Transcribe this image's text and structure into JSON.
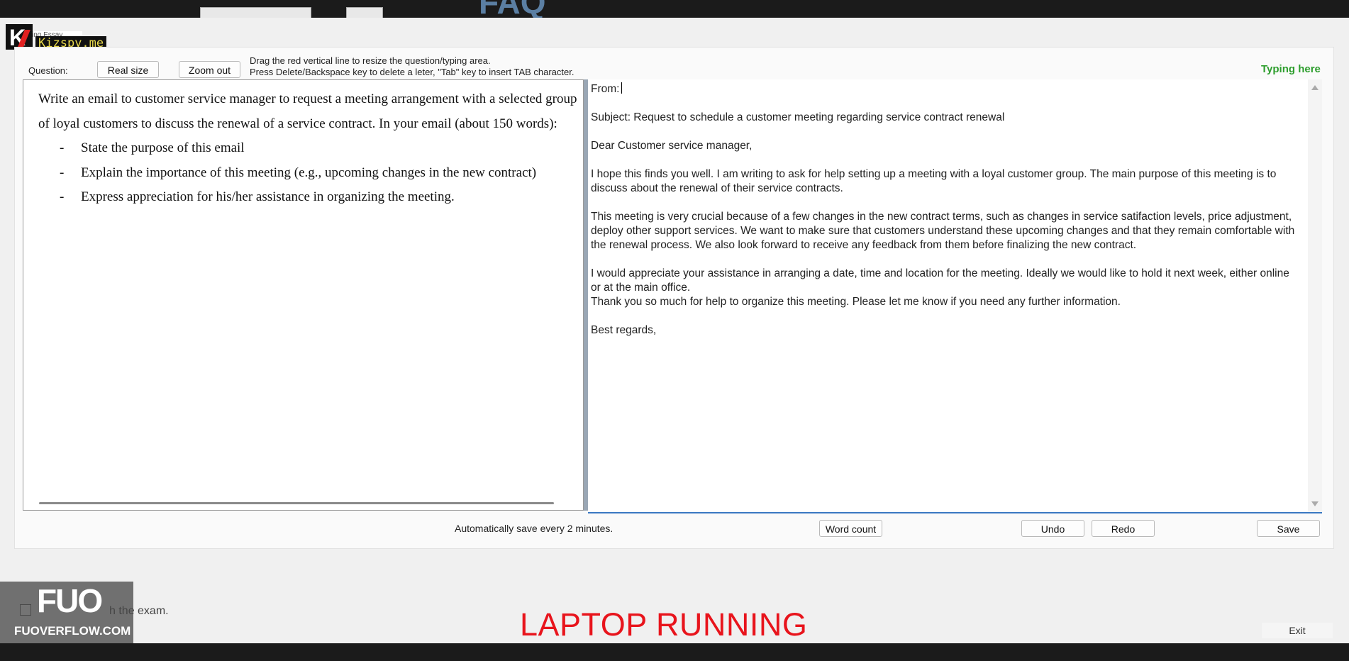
{
  "watermarks": {
    "kizspy_badge": "K",
    "kizspy_text": "Kizspy.me",
    "ghost_tab": "iting Essay",
    "fuo_big": "FUO",
    "fuo_small": "FUOVERFLOW.COM"
  },
  "toolbar": {
    "question_label": "Question:",
    "real_size_button": "Real size",
    "zoom_out_button": "Zoom out",
    "hint_line1": "Drag the red vertical line to resize the question/typing area.",
    "hint_line2": "Press Delete/Backspace key to delete a leter, \"Tab\" key to insert TAB character.",
    "typing_here": "Typing here"
  },
  "question": {
    "prompt": "Write an email to customer service manager to request a meeting arrangement with a selected group of loyal customers to discuss the renewal of a service contract. In your email (about 150 words):",
    "bullets": [
      "State the purpose of this email",
      "Explain the importance of this meeting (e.g., upcoming changes in the new contract)",
      "Express appreciation for his/her assistance in organizing the meeting."
    ],
    "bullet_marker": "-"
  },
  "answer": {
    "from": "From:",
    "subject": "Subject: Request to schedule a customer meeting regarding service contract renewal",
    "greeting": "Dear Customer service manager,",
    "para1": "I hope this finds you well. I am writing to ask for help setting up a meeting with a loyal customer group. The main purpose of this meeting is to discuss about the renewal of their service contracts.",
    "para2": "This meeting is very crucial because of a few changes in the new contract terms, such as changes in service satifaction levels, price adjustment, deploy other support services. We want to make sure that customers understand these upcoming changes and that they remain comfortable with the renewal process. We also look forward to receive any feedback from them before finalizing the new contract.",
    "para3": "I would appreciate your assistance in arranging a date, time and location for the meeting. Ideally we would like to hold it next week, either online or at the main office.",
    "para4": "Thank you so much for help to organize this meeting. Please let me know if you need any further information.",
    "closing": "Best regards,"
  },
  "footer": {
    "autosave": "Automatically save every 2 minutes.",
    "word_count_button": "Word count",
    "undo_button": "Undo",
    "redo_button": "Redo",
    "save_button": "Save",
    "finish_label": "h the exam.",
    "laptop_running": "LAPTOP RUNNING",
    "exit_button": "Exit"
  },
  "colors": {
    "typing_here": "#2e9e2e",
    "laptop_running": "#e8141c",
    "typing_border": "#3a78c2"
  }
}
